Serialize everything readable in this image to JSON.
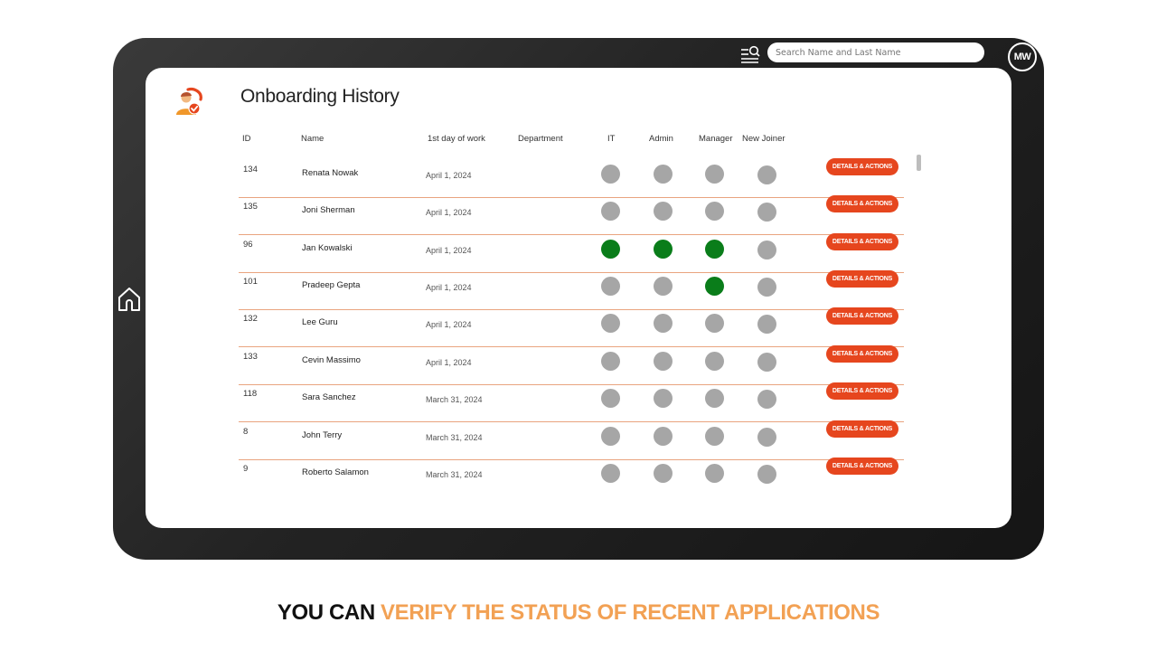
{
  "search": {
    "placeholder": "Search Name and Last Name"
  },
  "user": {
    "initials": "MW"
  },
  "page": {
    "title": "Onboarding History"
  },
  "columns": {
    "id": "ID",
    "name": "Name",
    "first_day": "1st day of work",
    "department": "Department",
    "it": "IT",
    "admin": "Admin",
    "manager": "Manager",
    "new_joiner": "New Joiner"
  },
  "action_label": "DETAILS & ACTIONS",
  "status_colors": {
    "complete": "#0a7d1a",
    "pending": "#a6a6a6",
    "accent": "#e6461e"
  },
  "rows": [
    {
      "id": "134",
      "name": "Renata  Nowak",
      "date": "April 1, 2024",
      "department": "",
      "status": [
        "pending",
        "pending",
        "pending",
        "pending"
      ]
    },
    {
      "id": "135",
      "name": "Joni Sherman",
      "date": "April 1, 2024",
      "department": "",
      "status": [
        "pending",
        "pending",
        "pending",
        "pending"
      ]
    },
    {
      "id": "96",
      "name": "Jan Kowalski",
      "date": "April 1, 2024",
      "department": "",
      "status": [
        "complete",
        "complete",
        "complete",
        "pending"
      ]
    },
    {
      "id": "101",
      "name": "Pradeep Gepta",
      "date": "April 1, 2024",
      "department": "",
      "status": [
        "pending",
        "pending",
        "complete",
        "pending"
      ]
    },
    {
      "id": "132",
      "name": "Lee Guru",
      "date": "April 1, 2024",
      "department": "",
      "status": [
        "pending",
        "pending",
        "pending",
        "pending"
      ]
    },
    {
      "id": "133",
      "name": "Cevin Massimo",
      "date": "April 1, 2024",
      "department": "",
      "status": [
        "pending",
        "pending",
        "pending",
        "pending"
      ]
    },
    {
      "id": "118",
      "name": "Sara Sanchez",
      "date": "March 31, 2024",
      "department": "",
      "status": [
        "pending",
        "pending",
        "pending",
        "pending"
      ]
    },
    {
      "id": "8",
      "name": "John Terry",
      "date": "March 31, 2024",
      "department": "",
      "status": [
        "pending",
        "pending",
        "pending",
        "pending"
      ]
    },
    {
      "id": "9",
      "name": "Roberto Salamon",
      "date": "March 31, 2024",
      "department": "",
      "status": [
        "pending",
        "pending",
        "pending",
        "pending"
      ]
    }
  ],
  "caption": {
    "part1": "YOU CAN ",
    "part2": "VERIFY THE STATUS OF RECENT APPLICATIONS"
  }
}
